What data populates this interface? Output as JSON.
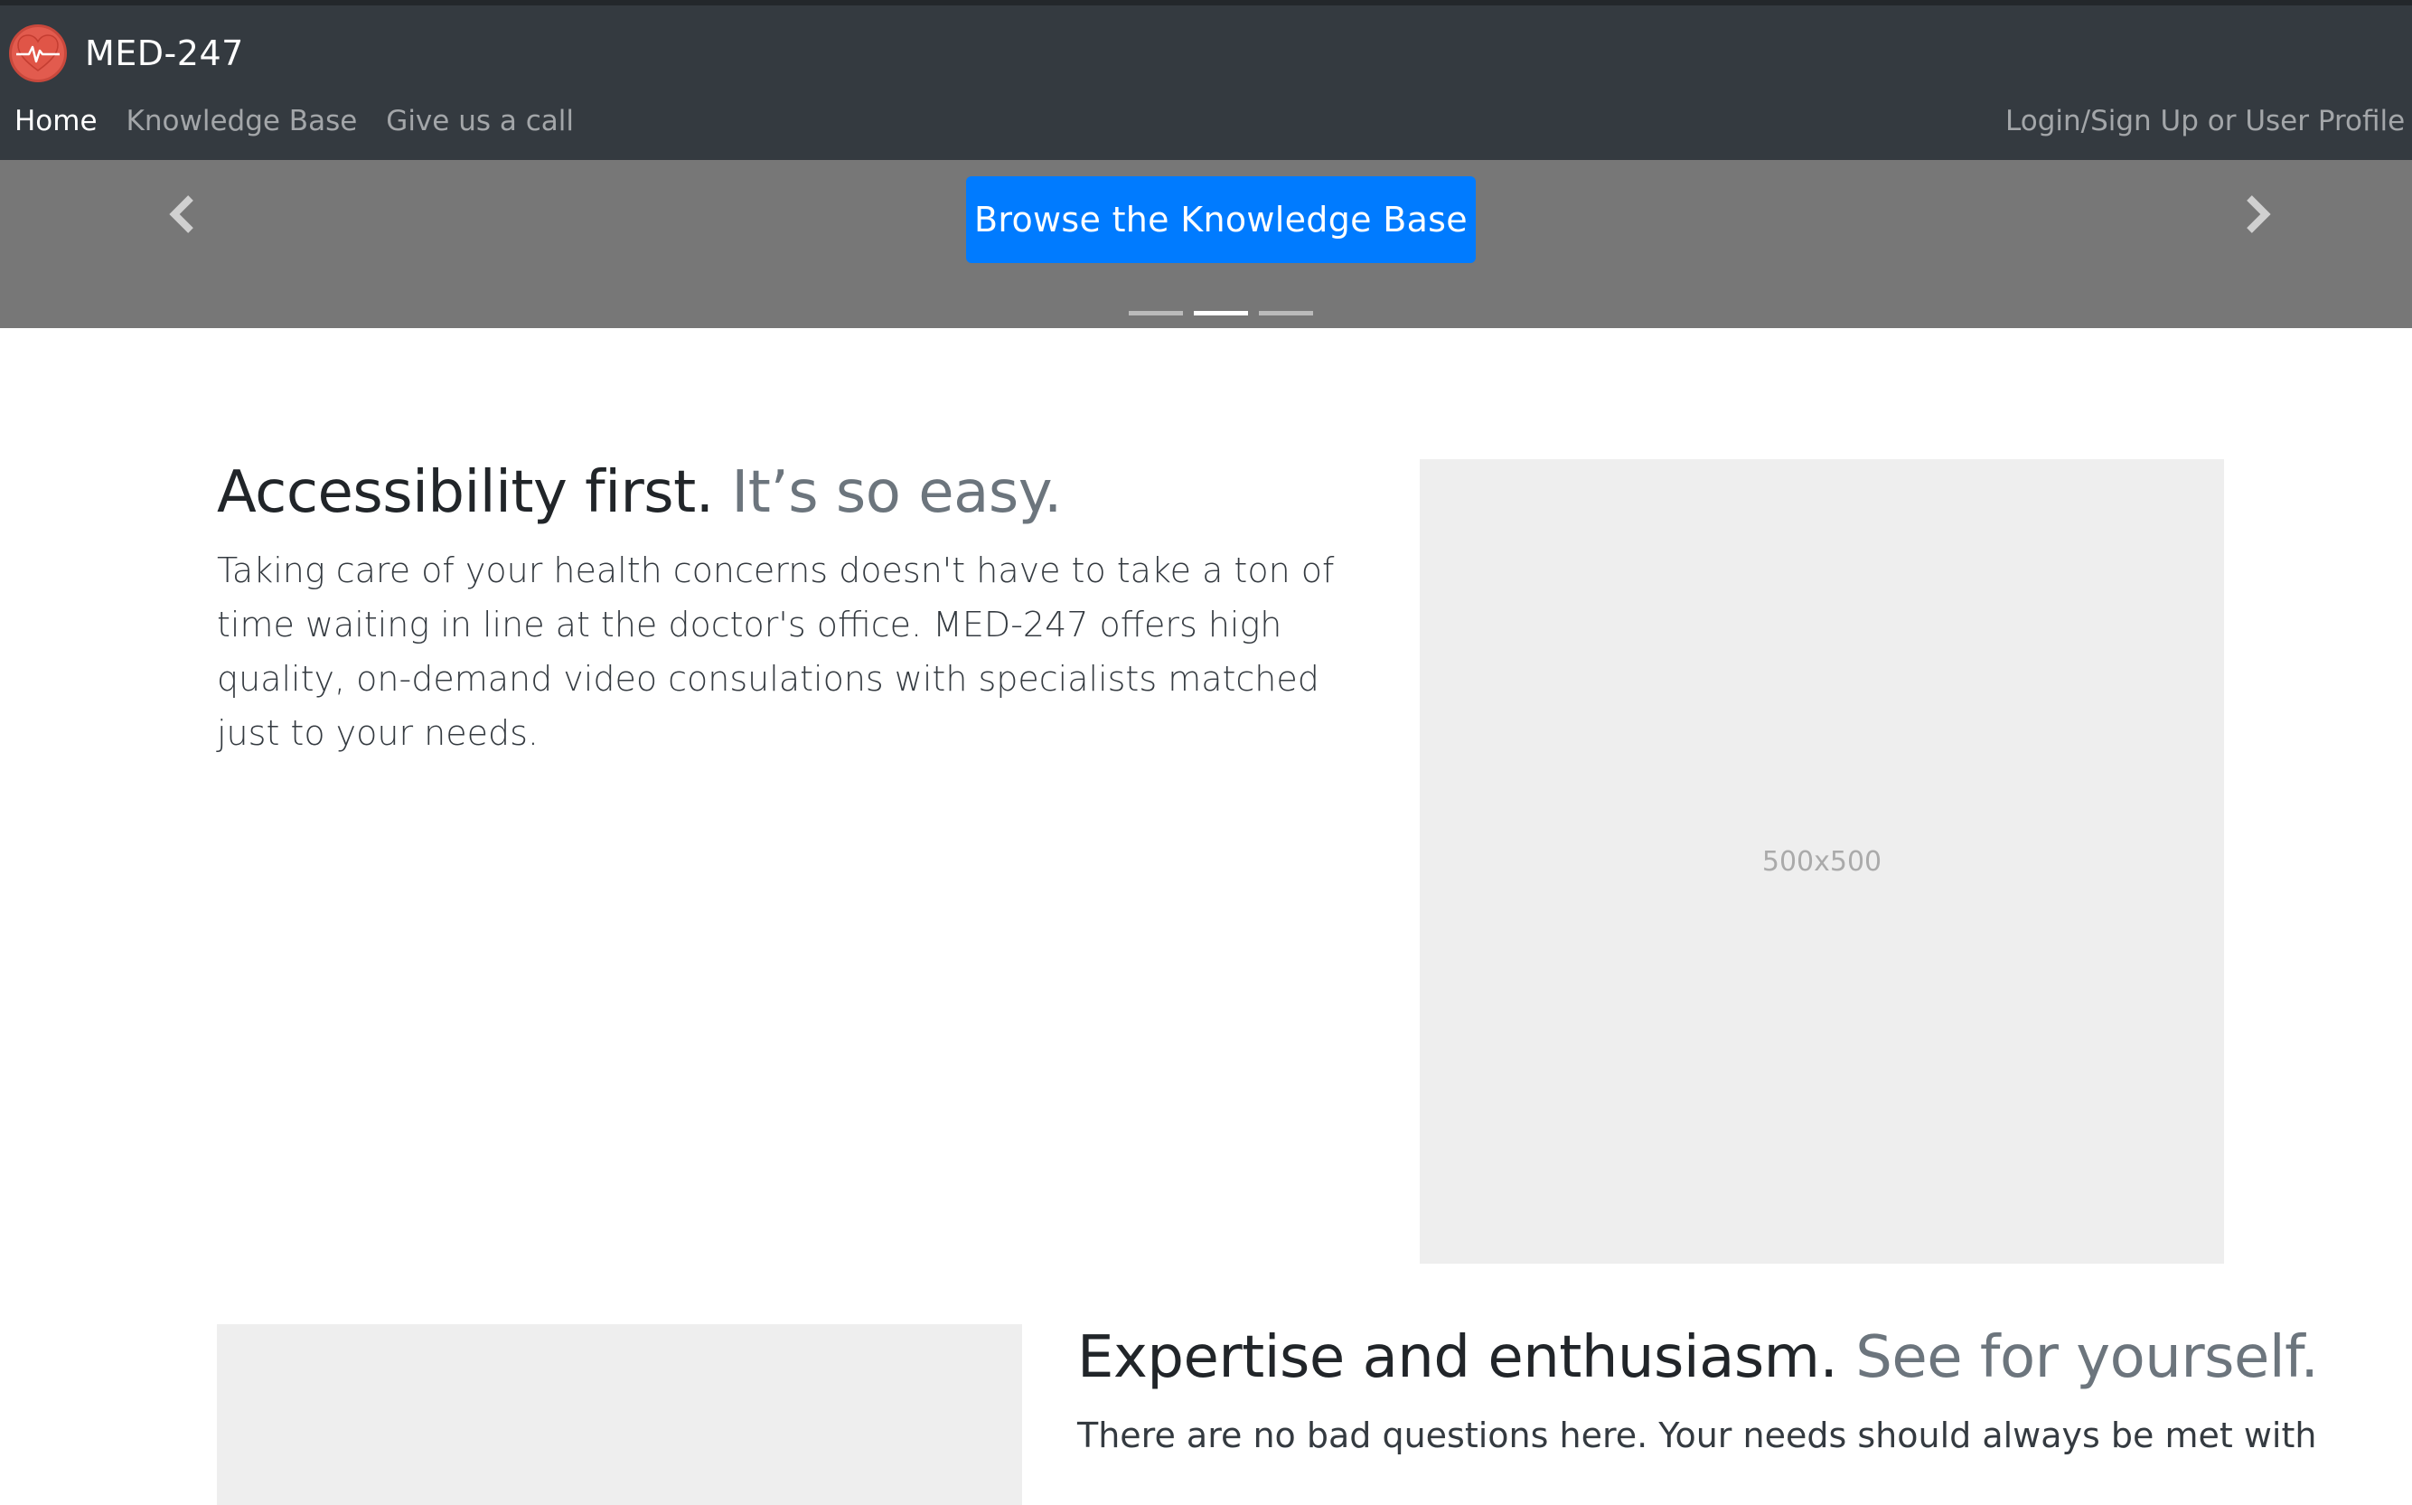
{
  "brand": {
    "name": "MED-247",
    "logo_color": "#e25b4e"
  },
  "nav": {
    "items": [
      {
        "label": "Home",
        "active": true
      },
      {
        "label": "Knowledge Base",
        "active": false
      },
      {
        "label": "Give us a call",
        "active": false
      }
    ],
    "right_label": "Login/Sign Up or User Profile Li"
  },
  "carousel": {
    "cta_label": "Browse the Knowledge Base",
    "cta_color": "#007bff",
    "prev_icon": "chevron-left-icon",
    "next_icon": "chevron-right-icon",
    "indicator_count": 3,
    "active_indicator": 2
  },
  "features": [
    {
      "heading": "Accessibility first.",
      "heading_muted": "It’s so easy.",
      "text": "Taking care of your health concerns doesn't have to take a ton of time waiting in line at the doctor's office. MED-247 offers high quality, on-demand video consulations with specialists matched just to your needs.",
      "image_label": "500x500"
    },
    {
      "heading": "Expertise and enthusiasm.",
      "heading_muted": "See for yourself.",
      "text": "There are no bad questions here. Your needs should always be met with",
      "image_label": ""
    }
  ]
}
